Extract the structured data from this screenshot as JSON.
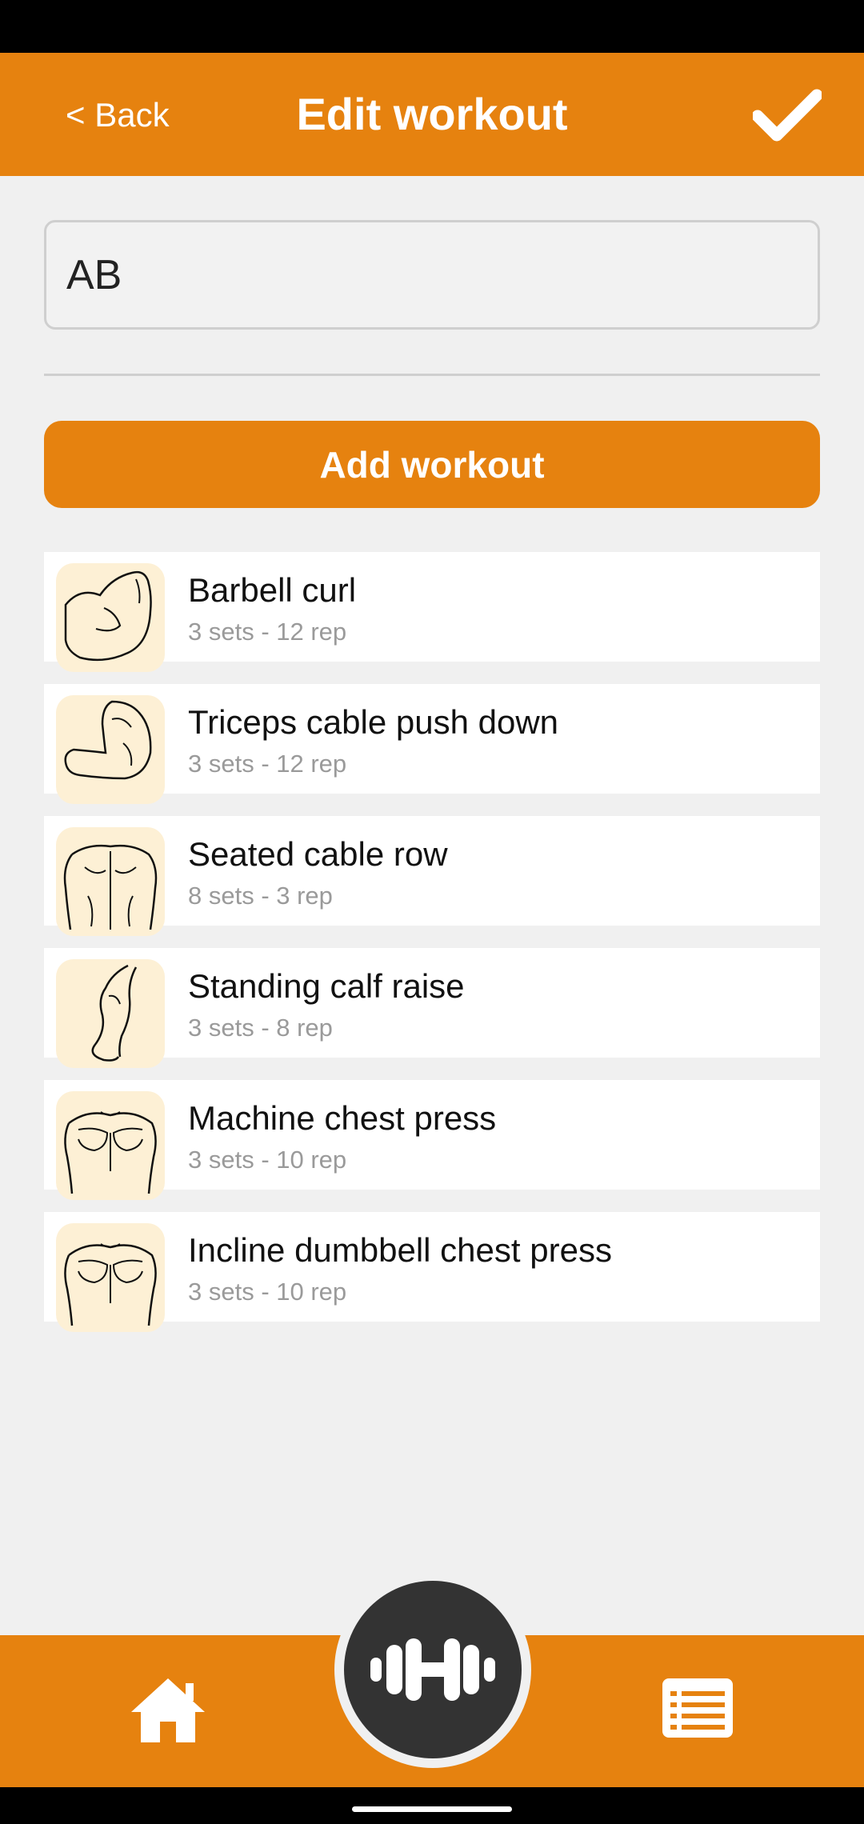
{
  "header": {
    "back_label": "< Back",
    "title": "Edit workout",
    "confirm_icon": "checkmark-icon"
  },
  "workout_name": {
    "value": "AB"
  },
  "add_button": {
    "label": "Add workout"
  },
  "exercises": [
    {
      "name": "Barbell curl",
      "detail": "3 sets - 12 rep",
      "icon": "biceps-icon"
    },
    {
      "name": "Triceps cable push down",
      "detail": "3 sets - 12 rep",
      "icon": "triceps-icon"
    },
    {
      "name": "Seated cable row",
      "detail": "8 sets - 3 rep",
      "icon": "back-icon"
    },
    {
      "name": "Standing calf raise",
      "detail": "3 sets - 8 rep",
      "icon": "calf-icon"
    },
    {
      "name": "Machine chest press",
      "detail": "3 sets - 10 rep",
      "icon": "chest-icon"
    },
    {
      "name": "Incline dumbbell chest press",
      "detail": "3 sets - 10 rep",
      "icon": "chest-icon"
    }
  ],
  "bottom_nav": {
    "items": [
      "home-icon",
      "dumbbell-icon",
      "list-icon"
    ]
  },
  "colors": {
    "accent": "#e6820f",
    "background": "#f0f0f0",
    "thumb_bg": "#fdf0d5",
    "fab": "#333333"
  }
}
